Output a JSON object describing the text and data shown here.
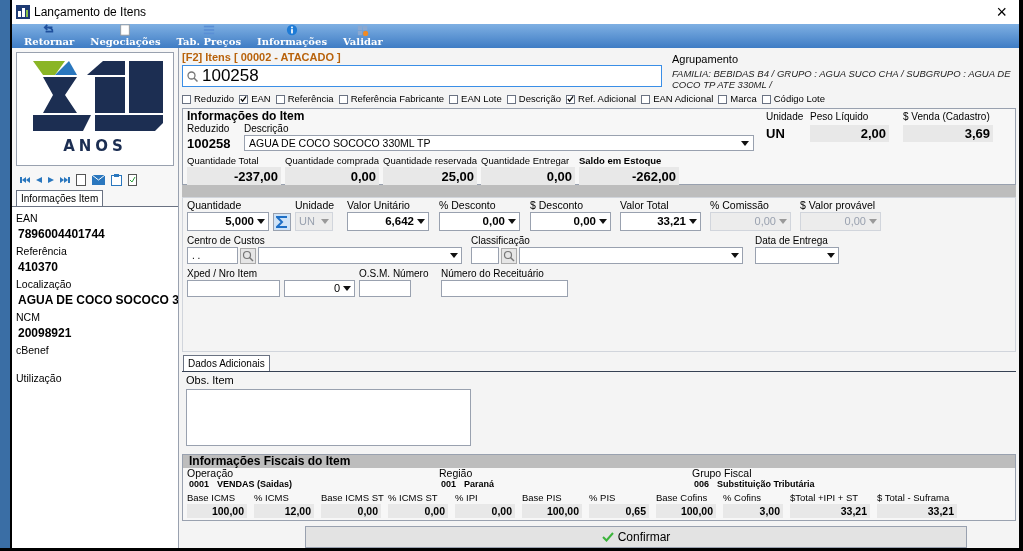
{
  "window": {
    "title": "Lançamento de Itens",
    "close": "×"
  },
  "toolbar": [
    {
      "label": "Retornar",
      "kind": "back"
    },
    {
      "label": "Negociações",
      "kind": "doc"
    },
    {
      "label": "Tab. Preços",
      "kind": "list"
    },
    {
      "label": "Informações",
      "kind": "info"
    },
    {
      "label": "Validar",
      "kind": "validate"
    }
  ],
  "logo": {
    "caption": "ANOS"
  },
  "side_tab": {
    "label": "Informações Item",
    "selected": true
  },
  "side_fields": [
    {
      "label": "EAN",
      "value": "7896004401744"
    },
    {
      "label": "Referência",
      "value": "410370"
    },
    {
      "label": "Localização",
      "value": "AGUA DE COCO SOCOCO 3"
    },
    {
      "label": "NCM",
      "value": "20098921"
    },
    {
      "label": "cBenef"
    },
    {
      "label": "Utilização"
    }
  ],
  "search": {
    "header": "[F2] Itens [ 00002 - ATACADO ]",
    "value": "100258"
  },
  "agrupamento": {
    "label": "Agrupamento",
    "text": "FAMILIA: BEBIDAS B4 / GRUPO : AGUA  SUCO  CHA / SUBGRUPO : AGUA DE COCO TP ATE 330ML /"
  },
  "search_options": [
    {
      "label": "Reduzido",
      "checked": false
    },
    {
      "label": "EAN",
      "checked": true
    },
    {
      "label": "Referência",
      "checked": false
    },
    {
      "label": "Referência Fabricante",
      "checked": false
    },
    {
      "label": "EAN Lote",
      "checked": false
    },
    {
      "label": "Descrição",
      "checked": false
    },
    {
      "label": "Ref. Adicional",
      "checked": true
    },
    {
      "label": "EAN Adicional",
      "checked": false
    },
    {
      "label": "Marca",
      "checked": false
    },
    {
      "label": "Código Lote",
      "checked": false
    }
  ],
  "item_info": {
    "title": "Informações do Item",
    "reduzido": {
      "label": "Reduzido",
      "value": "100258"
    },
    "descricao": {
      "label": "Descrição",
      "value": "AGUA DE COCO SOCOCO 330ML TP"
    },
    "unidade": {
      "label": "Unidade",
      "value": "UN"
    },
    "peso": {
      "label": "Peso Líquido",
      "value": "2,00"
    },
    "venda": {
      "label": "$ Venda (Cadastro)",
      "value": "3,69"
    },
    "quantities": [
      {
        "label": "Quantidade Total",
        "value": "-237,00",
        "bold": false
      },
      {
        "label": "Quantidade comprada",
        "value": "0,00",
        "bold": false
      },
      {
        "label": "Quantidade reservada",
        "value": "25,00",
        "bold": false
      },
      {
        "label": "Quantidade Entregar",
        "value": "0,00",
        "bold": false
      },
      {
        "label": "Saldo em Estoque",
        "value": "-262,00",
        "bold": true
      }
    ]
  },
  "order_fields": [
    {
      "label": "Quantidade",
      "value": "5,000",
      "disabled": false
    },
    {
      "label": "Unidade",
      "value": "UN",
      "disabled": true
    },
    {
      "label": "Valor Unitário",
      "value": "6,642",
      "disabled": false
    },
    {
      "label": "% Desconto",
      "value": "0,00",
      "disabled": false
    },
    {
      "label": "$ Desconto",
      "value": "0,00",
      "disabled": false
    },
    {
      "label": "Valor Total",
      "value": "33,21",
      "disabled": false
    },
    {
      "label": "% Comissão",
      "value": "0,00",
      "disabled": true
    },
    {
      "label": "$ Valor provável",
      "value": "0,00",
      "disabled": true
    }
  ],
  "centro_custos": {
    "label": "Centro de Custos",
    "code": ". ."
  },
  "classificacao": {
    "label": "Classificação"
  },
  "data_entrega": {
    "label": "Data de Entrega"
  },
  "xped": {
    "label": "Xped / Nro Item",
    "item": "0"
  },
  "osm": {
    "label": "O.S.M. Número"
  },
  "receituario": {
    "label": "Número do Receituário"
  },
  "extra_tab": {
    "label": "Dados Adicionais",
    "selected": true
  },
  "obs": {
    "label": "Obs. Item"
  },
  "fiscal": {
    "title": "Informações Fiscais do Item",
    "groups": [
      {
        "label": "Operação",
        "code": "0001",
        "name": "VENDAS (Saidas)"
      },
      {
        "label": "Região",
        "code": "001",
        "name": "Paraná"
      },
      {
        "label": "Grupo Fiscal",
        "code": "006",
        "name": "Substituição Tributária"
      }
    ],
    "values": [
      {
        "label": "Base ICMS",
        "value": "100,00"
      },
      {
        "label": "% ICMS",
        "value": "12,00"
      },
      {
        "label": "Base ICMS ST",
        "value": "0,00"
      },
      {
        "label": "% ICMS ST",
        "value": "0,00"
      },
      {
        "label": "% IPI",
        "value": "0,00"
      },
      {
        "label": "Base PIS",
        "value": "100,00"
      },
      {
        "label": "% PIS",
        "value": "0,65"
      },
      {
        "label": "Base Cofins",
        "value": "100,00"
      },
      {
        "label": "% Cofins",
        "value": "3,00"
      },
      {
        "label": "$Total +IPI + ST",
        "value": "33,21"
      },
      {
        "label": "$ Total - Suframa",
        "value": "33,21"
      }
    ]
  },
  "confirm": {
    "label": "Confirmar"
  }
}
